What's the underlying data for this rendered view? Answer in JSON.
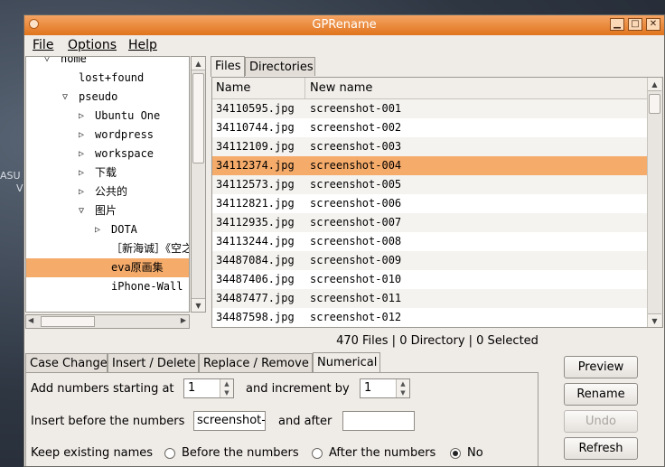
{
  "desktop": {
    "side_text_1": "ASU",
    "side_text_2": "V"
  },
  "window": {
    "title": "GPRename"
  },
  "menu": {
    "file": "File",
    "options": "Options",
    "help": "Help"
  },
  "tree": {
    "items": [
      {
        "label": "home",
        "depth": 1,
        "expander": "open"
      },
      {
        "label": "lost+found",
        "depth": 2,
        "expander": "none"
      },
      {
        "label": "pseudo",
        "depth": 2,
        "expander": "open"
      },
      {
        "label": "Ubuntu One",
        "depth": 3,
        "expander": "closed"
      },
      {
        "label": "wordpress",
        "depth": 3,
        "expander": "closed"
      },
      {
        "label": "workspace",
        "depth": 3,
        "expander": "closed"
      },
      {
        "label": "下载",
        "depth": 3,
        "expander": "closed"
      },
      {
        "label": "公共的",
        "depth": 3,
        "expander": "closed"
      },
      {
        "label": "图片",
        "depth": 3,
        "expander": "open"
      },
      {
        "label": "DOTA",
        "depth": 4,
        "expander": "closed"
      },
      {
        "label": "［新海诚］《空之",
        "depth": 4,
        "expander": "none"
      },
      {
        "label": "eva原画集",
        "depth": 4,
        "expander": "none",
        "selected": true
      },
      {
        "label": "iPhone-Wall",
        "depth": 4,
        "expander": "none"
      }
    ]
  },
  "top_tabs": {
    "files": "Files",
    "directories": "Directories"
  },
  "file_list": {
    "col_name": "Name",
    "col_new_name": "New name",
    "rows": [
      {
        "name": "34110595.jpg",
        "new_name": "screenshot-001"
      },
      {
        "name": "34110744.jpg",
        "new_name": "screenshot-002"
      },
      {
        "name": "34112109.jpg",
        "new_name": "screenshot-003"
      },
      {
        "name": "34112374.jpg",
        "new_name": "screenshot-004",
        "selected": true
      },
      {
        "name": "34112573.jpg",
        "new_name": "screenshot-005"
      },
      {
        "name": "34112821.jpg",
        "new_name": "screenshot-006"
      },
      {
        "name": "34112935.jpg",
        "new_name": "screenshot-007"
      },
      {
        "name": "34113244.jpg",
        "new_name": "screenshot-008"
      },
      {
        "name": "34487084.jpg",
        "new_name": "screenshot-009"
      },
      {
        "name": "34487406.jpg",
        "new_name": "screenshot-010"
      },
      {
        "name": "34487477.jpg",
        "new_name": "screenshot-011"
      },
      {
        "name": "34487598.jpg",
        "new_name": "screenshot-012"
      }
    ]
  },
  "status": "470 Files | 0 Directory | 0 Selected",
  "bottom_tabs": {
    "case_change": "Case Change",
    "insert_delete": "Insert / Delete",
    "replace_remove": "Replace / Remove",
    "numerical": "Numerical"
  },
  "numerical": {
    "start_label": "Add numbers starting at",
    "start_value": "1",
    "increment_label": "and increment by",
    "increment_value": "1",
    "insert_before_label": "Insert before the numbers",
    "insert_before_value": "screenshot-",
    "and_after_label": "and after",
    "and_after_value": "",
    "keep_label": "Keep existing names",
    "opt_before": "Before the numbers",
    "opt_after": "After the numbers",
    "opt_no": "No",
    "selected_option": "No"
  },
  "buttons": {
    "preview": "Preview",
    "rename": "Rename",
    "undo": "Undo",
    "refresh": "Refresh"
  },
  "colors": {
    "accent": "#f5ab6a",
    "titlebar": "#e98a3c"
  }
}
